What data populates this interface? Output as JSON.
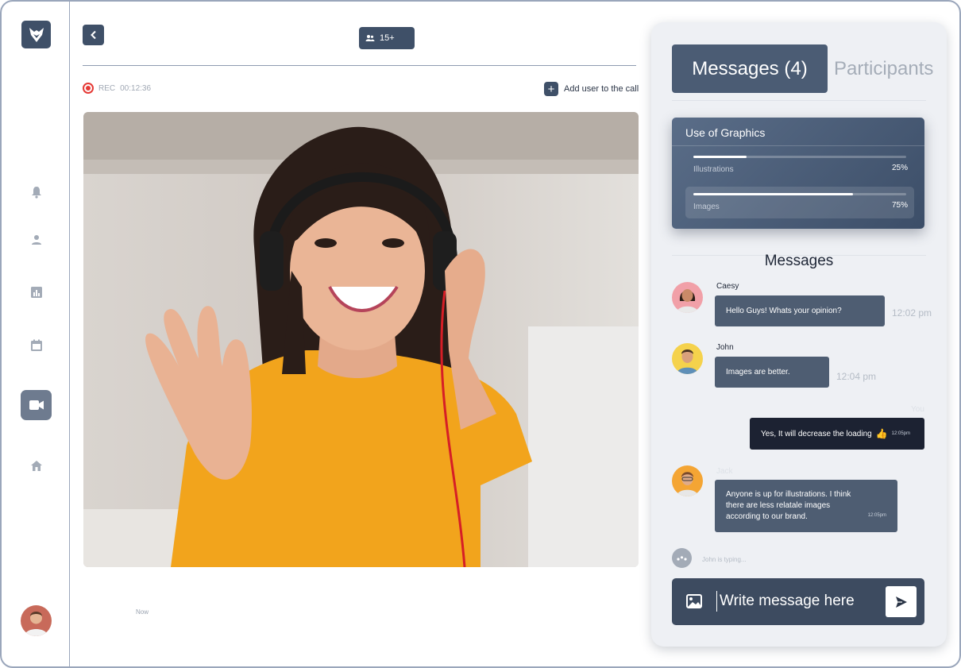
{
  "header": {
    "participants_count": "15+",
    "rec_label": "REC",
    "rec_time": "00:12:36",
    "add_user_label": "Add user to the call"
  },
  "video": {
    "now_label": "Now"
  },
  "panel": {
    "tabs": [
      {
        "label": "Messages (4)",
        "active": true
      },
      {
        "label": "Participants",
        "active": false
      }
    ],
    "graphics_card": {
      "title": "Use of Graphics",
      "rows": [
        {
          "label": "Illustrations",
          "percent_label": "25%",
          "value": 0.25
        },
        {
          "label": "Images",
          "percent_label": "75%",
          "value": 0.75
        }
      ]
    },
    "messages_heading": "Messages",
    "messages": [
      {
        "name": "Caesy",
        "text": "Hello Guys! Whats your opinion?",
        "time": "12:02 pm"
      },
      {
        "name": "John",
        "text": "Images are better.",
        "time": "12:04 pm"
      },
      {
        "name": "You",
        "text": "Yes, It will decrease the loading",
        "time": "12:05pm",
        "emoji": "👍"
      },
      {
        "name": "Jack",
        "text": "Anyone is up for illustrations. I think there are less relatale images according to our brand.",
        "time": "12:05pm"
      }
    ],
    "typing_text": "John is typing...",
    "composer_placeholder": "Write message here"
  },
  "colors": {
    "primary": "#3f5068",
    "panel_bg": "#eef0f4",
    "rec_red": "#e53935",
    "dark_bubble": "#1c2232"
  },
  "icons": [
    "fox-logo-icon",
    "bell-icon",
    "user-icon",
    "chart-icon",
    "calendar-icon",
    "video-camera-icon",
    "home-icon",
    "back-chevron-icon",
    "people-icon",
    "plus-icon",
    "image-icon",
    "send-icon"
  ]
}
